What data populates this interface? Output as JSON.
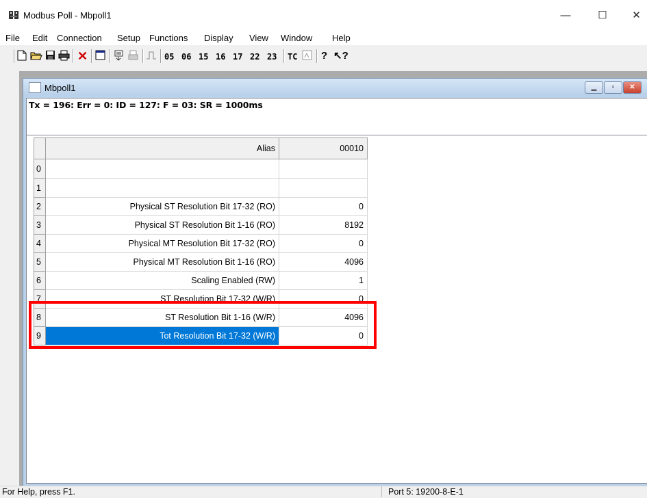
{
  "window": {
    "title": "Modbus Poll - Mbpoll1",
    "minimize": "—",
    "maximize": "☐",
    "close": "✕"
  },
  "menu": [
    "File",
    "Edit",
    "Connection",
    "Setup",
    "Functions",
    "Display",
    "View",
    "Window",
    "Help"
  ],
  "toolbar": {
    "function_codes": [
      "05",
      "06",
      "15",
      "16",
      "17",
      "22",
      "23"
    ],
    "tc_label": "TC",
    "icons": [
      "new-icon",
      "open-icon",
      "save-icon",
      "print-icon",
      "delete-icon",
      "window-icon",
      "read-icon",
      "print-preview-icon",
      "pulse-icon",
      "help-icon",
      "context-help-icon"
    ]
  },
  "child": {
    "title": "Mbpoll1",
    "status_line": "Tx = 196: Err = 0: ID = 127: F = 03: SR = 1000ms"
  },
  "grid": {
    "header": {
      "alias": "Alias",
      "address": "00010"
    },
    "rows": [
      {
        "num": "0",
        "alias": "",
        "value": ""
      },
      {
        "num": "1",
        "alias": "",
        "value": ""
      },
      {
        "num": "2",
        "alias": "Physical ST Resolution Bit 17-32 (RO)",
        "value": "0"
      },
      {
        "num": "3",
        "alias": "Physical ST Resolution Bit 1-16 (RO)",
        "value": "8192"
      },
      {
        "num": "4",
        "alias": "Physical MT Resolution Bit 17-32 (RO)",
        "value": "0"
      },
      {
        "num": "5",
        "alias": "Physical MT Resolution Bit 1-16 (RO)",
        "value": "4096"
      },
      {
        "num": "6",
        "alias": "Scaling Enabled (RW)",
        "value": "1"
      },
      {
        "num": "7",
        "alias": "ST Resolution Bit 17-32 (W/R)",
        "value": "0"
      },
      {
        "num": "8",
        "alias": "ST Resolution Bit 1-16 (W/R)",
        "value": "4096"
      },
      {
        "num": "9",
        "alias": "Tot Resolution Bit 17-32 (W/R)",
        "value": "0"
      }
    ],
    "selected_row": "9"
  },
  "statusbar": {
    "help": "For Help, press F1.",
    "port": "Port 5: 19200-8-E-1"
  },
  "colors": {
    "selection": "#0078d7",
    "highlight_box": "#ff0000",
    "mdi_caption": "#b9d1ea"
  }
}
